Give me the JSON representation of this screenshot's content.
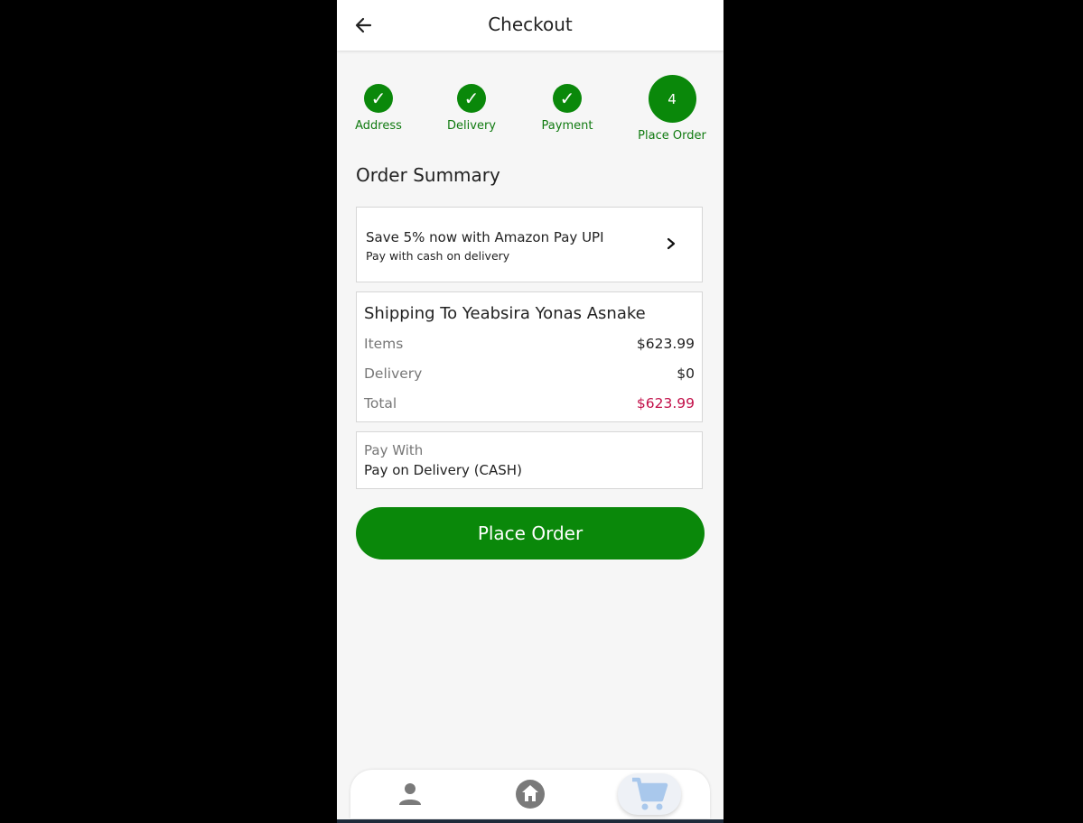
{
  "appbar": {
    "title": "Checkout",
    "back_icon": "arrow-left-icon"
  },
  "stepper": {
    "steps": [
      {
        "label": "Address",
        "status": "completed",
        "symbol": "✓"
      },
      {
        "label": "Delivery",
        "status": "completed",
        "symbol": "✓"
      },
      {
        "label": "Payment",
        "status": "completed",
        "symbol": "✓"
      },
      {
        "label": "Place Order",
        "status": "current",
        "symbol": "4"
      }
    ]
  },
  "summary": {
    "title": "Order Summary",
    "promo": {
      "line1": "Save 5% now with Amazon Pay UPI",
      "line2": "Pay with cash on delivery",
      "icon": "chevron-right-icon"
    },
    "shipping": {
      "heading": "Shipping To Yeabsira Yonas Asnake",
      "items_label": "Items",
      "items_value": "$623.99",
      "delivery_label": "Delivery",
      "delivery_value": "$0",
      "total_label": "Total",
      "total_value": "$623.99"
    },
    "payment": {
      "label": "Pay With",
      "value": "Pay on Delivery (CASH)"
    },
    "place_order_button": "Place Order"
  },
  "bottom_nav": {
    "items": [
      {
        "icon": "person-icon",
        "active": false
      },
      {
        "icon": "home-icon",
        "active": false
      },
      {
        "icon": "cart-icon",
        "active": true
      }
    ]
  },
  "colors": {
    "accent": "#0a880a",
    "total": "#c21049",
    "background": "#f6f6f6"
  }
}
